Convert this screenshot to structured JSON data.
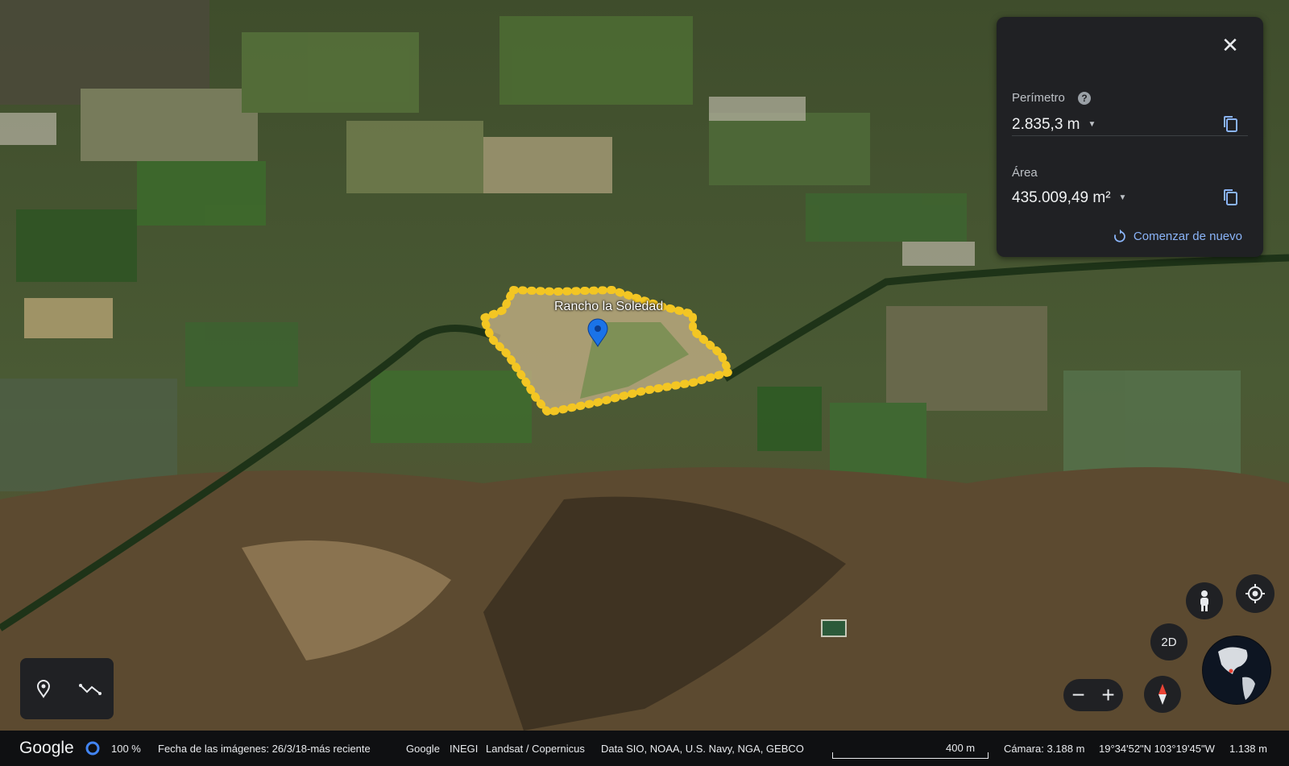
{
  "measurement_panel": {
    "perimeter_label": "Perímetro",
    "perimeter_help": "?",
    "perimeter_value": "2.835,3 m",
    "area_label": "Área",
    "area_value": "435.009,49 m²",
    "restart_label": "Comenzar de nuevo",
    "close_icon": "close-icon",
    "copy_icon": "copy-icon"
  },
  "map": {
    "place_label": "Rancho la Soledad",
    "pin_color": "#1a73e8",
    "polygon_color": "#f3c623"
  },
  "controls": {
    "view_mode_label": "2D",
    "zoom_out_label": "−",
    "zoom_in_label": "+",
    "tools": [
      "pin-icon",
      "measure-path-icon"
    ],
    "pegman_icon": "pegman-icon",
    "locate_icon": "my-location-icon",
    "compass_icon": "compass-icon"
  },
  "status_bar": {
    "logo": "Google",
    "loading_percent": "100 %",
    "imagery_date": "Fecha de las imágenes: 26/3/18-más reciente",
    "attributions": [
      "Google",
      "INEGI",
      "Landsat / Copernicus",
      "Data SIO, NOAA, U.S. Navy, NGA, GEBCO"
    ],
    "scale_label": "400 m",
    "camera": "Cámara: 3.188 m",
    "coordinates": "19°34'52\"N 103°19'45\"W",
    "altitude": "1.138 m"
  }
}
